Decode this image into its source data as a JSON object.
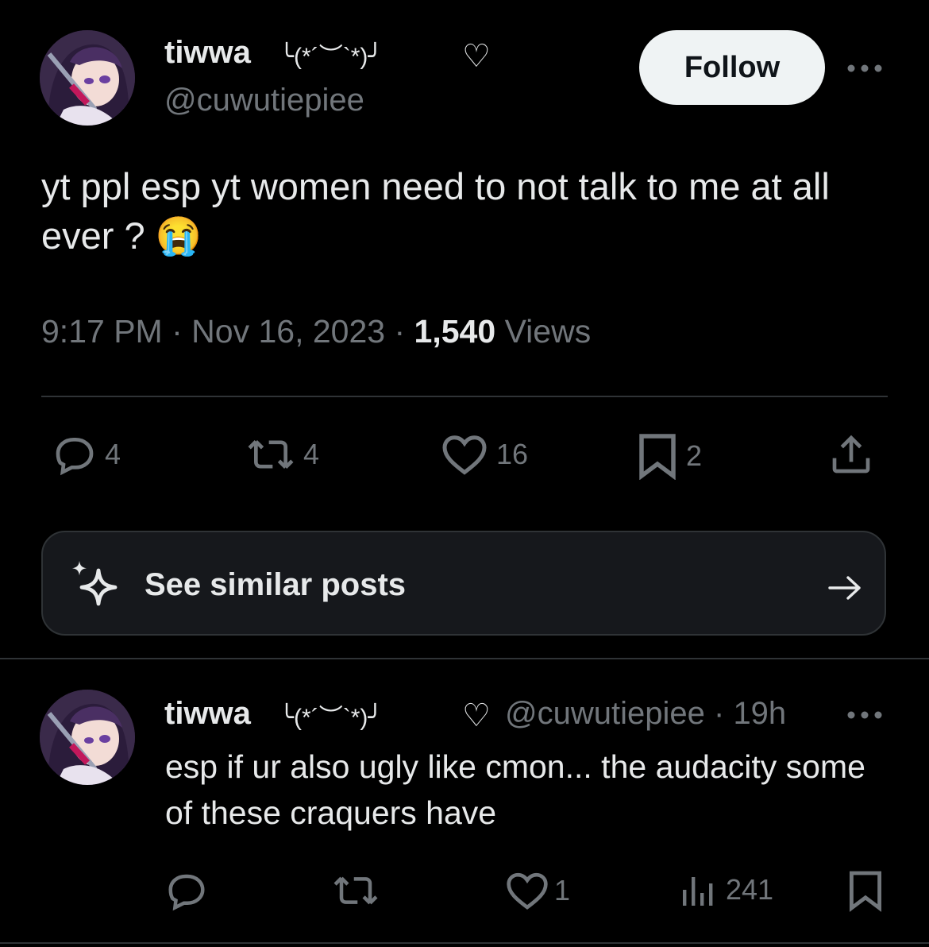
{
  "main_post": {
    "author": {
      "name": "tiwwa",
      "kaomoji": "╰(*´︶`*)╯",
      "heart": "♡",
      "handle": "@cuwutiepiee"
    },
    "follow_label": "Follow",
    "text": "yt ppl esp yt women need to not talk to me at all ever ? 😭",
    "time": "9:17 PM",
    "date": "Nov 16, 2023",
    "views_count": "1,540",
    "views_label": "Views",
    "separator": "·",
    "actions": {
      "replies": "4",
      "reposts": "4",
      "likes": "16",
      "bookmarks": "2"
    }
  },
  "similar_posts": {
    "label": "See similar posts",
    "arrow": "→"
  },
  "reply": {
    "author": {
      "name": "tiwwa",
      "kaomoji": "╰(*´︶`*)╯",
      "heart": "♡",
      "handle": "@cuwutiepiee",
      "separator": "·",
      "time": "19h"
    },
    "text": "esp if ur also ugly like cmon... the audacity some of these craquers have",
    "actions": {
      "replies": "",
      "reposts": "",
      "likes": "1",
      "views": "241"
    }
  },
  "colors": {
    "background": "#000000",
    "text_primary": "#e7e9ea",
    "text_secondary": "#71767b",
    "divider": "#2f3336",
    "follow_bg": "#eff3f4",
    "card_bg": "#16181c"
  },
  "icons": [
    "avatar",
    "more-icon",
    "reply-icon",
    "repost-icon",
    "like-icon",
    "bookmark-icon",
    "share-icon",
    "sparkle-icon",
    "arrow-right-icon",
    "views-icon"
  ]
}
